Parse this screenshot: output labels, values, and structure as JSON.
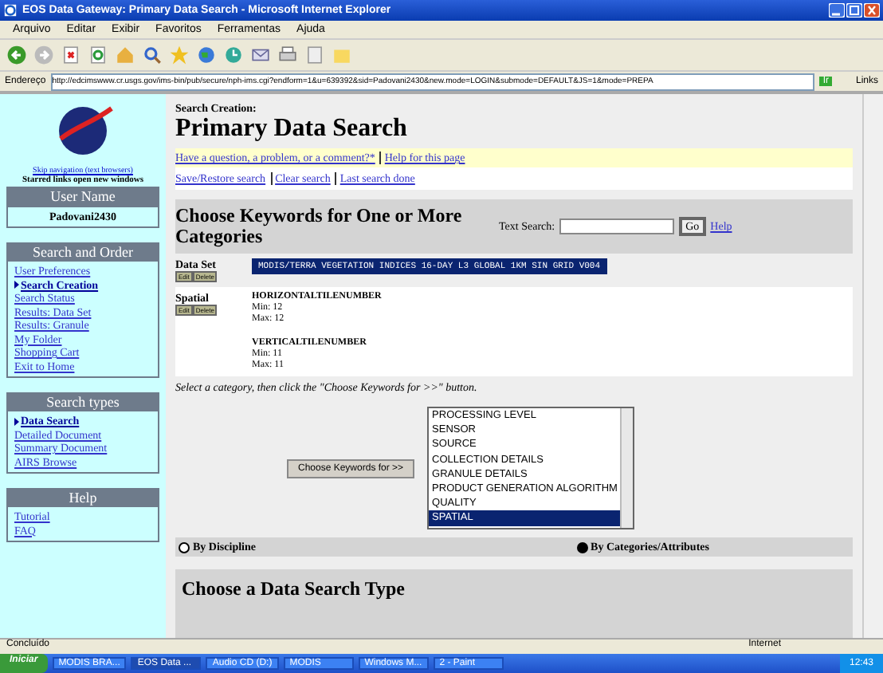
{
  "window": {
    "title": "EOS Data Gateway: Primary Data Search - Microsoft Internet Explorer"
  },
  "menu": [
    "Arquivo",
    "Editar",
    "Exibir",
    "Favoritos",
    "Ferramentas",
    "Ajuda"
  ],
  "address": {
    "label": "Endereço",
    "value": "http://edcimswww.cr.usgs.gov/ims-bin/pub/secure/nph-ims.cgi?endform=1&u=639392&sid=Padovani2430&new.mode=LOGIN&submode=DEFAULT&JS=1&mode=PREPA",
    "go": "Ir",
    "links": "Links"
  },
  "sidebar": {
    "skip_link": "Skip navigation (text browsers)",
    "note": "Starred links open new windows",
    "user_heading": "User Name",
    "user_name": "Padovani2430",
    "sections": [
      {
        "heading": "Search and Order",
        "items": [
          {
            "label": "User Preferences",
            "selected": false
          },
          {
            "label": "Search Creation",
            "selected": true
          },
          {
            "label": "Search Status",
            "selected": false
          },
          {
            "label": "Results: Data Set",
            "selected": false
          },
          {
            "label": "Results: Granule",
            "selected": false
          },
          {
            "label": "My Folder",
            "selected": false
          },
          {
            "label": "Shopping Cart",
            "selected": false
          },
          {
            "label": "Exit to Home",
            "selected": false
          }
        ]
      },
      {
        "heading": "Search types",
        "items": [
          {
            "label": "Data Search",
            "selected": true
          },
          {
            "label": "Detailed Document",
            "selected": false
          },
          {
            "label": "Summary Document",
            "selected": false
          },
          {
            "label": "AIRS Browse",
            "selected": false
          }
        ]
      },
      {
        "heading": "Help",
        "items": [
          {
            "label": "Tutorial",
            "selected": false
          },
          {
            "label": "FAQ",
            "selected": false
          }
        ]
      }
    ]
  },
  "content": {
    "breadcrumb": "Search Creation:",
    "title": "Primary Data Search",
    "help_links": [
      "Have a question, a problem, or a comment?*",
      "Help for this page"
    ],
    "search_links": [
      "Save/Restore search",
      "Clear search",
      "Last search done"
    ],
    "keywords_heading": "Choose Keywords for One or More Categories",
    "text_search_label": "Text Search:",
    "go_button": "Go",
    "help_link": "Help",
    "criteria": [
      {
        "label": "Data Set",
        "buttons": [
          "Edit",
          "Delete"
        ],
        "kind": "dataset",
        "value": "MODIS/TERRA VEGETATION INDICES 16-DAY L3 GLOBAL 1KM SIN GRID V004"
      },
      {
        "label": "Spatial",
        "buttons": [
          "Edit",
          "Delete"
        ],
        "kind": "attributes",
        "groups": [
          {
            "name": "HORIZONTALTILENUMBER",
            "lines": [
              "Min: 12",
              "Max: 12"
            ]
          },
          {
            "name": "VERTICALTILENUMBER",
            "lines": [
              "Min: 11",
              "Max: 11"
            ]
          }
        ]
      }
    ],
    "instruction": "Select a category, then click the \"Choose Keywords for >>\" button.",
    "choose_button": "Choose Keywords for >>",
    "categories": [
      {
        "label": "PROCESSING LEVEL",
        "selected": false
      },
      {
        "label": "SENSOR",
        "selected": false
      },
      {
        "label": "SOURCE",
        "selected": false
      },
      {
        "label": "COLLECTION DETAILS",
        "selected": false
      },
      {
        "label": "GRANULE DETAILS",
        "selected": false
      },
      {
        "label": "PRODUCT GENERATION ALGORITHM",
        "selected": false
      },
      {
        "label": "QUALITY",
        "selected": false
      },
      {
        "label": "SPATIAL",
        "selected": true
      }
    ],
    "modes": [
      {
        "label": "By Discipline",
        "selected": false
      },
      {
        "label": "By Categories/Attributes",
        "selected": true
      }
    ],
    "next_heading": "Choose a Data Search Type"
  },
  "status_bar": {
    "text": "Concluído",
    "zone": "Internet"
  },
  "taskbar": {
    "start": "Iniciar",
    "tasks": [
      {
        "label": "MODIS BRA...",
        "selected": false
      },
      {
        "label": "EOS Data ...",
        "selected": true
      },
      {
        "label": "Audio CD (D:)",
        "selected": false
      },
      {
        "label": "MODIS",
        "selected": false
      },
      {
        "label": "Windows M...",
        "selected": false
      },
      {
        "label": "2 - Paint",
        "selected": false
      }
    ],
    "clock": "12:43"
  }
}
